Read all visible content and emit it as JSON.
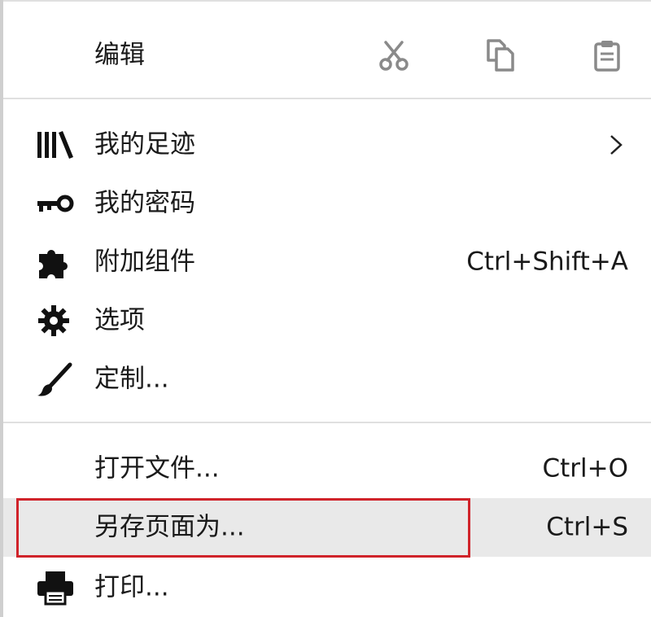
{
  "menu": {
    "edit": {
      "label": "编辑",
      "cut_icon": "scissors-icon",
      "copy_icon": "copy-icon",
      "paste_icon": "clipboard-icon"
    },
    "items": [
      {
        "label": "我的足迹",
        "icon": "library-icon",
        "submenu": true
      },
      {
        "label": "我的密码",
        "icon": "key-icon"
      },
      {
        "label": "附加组件",
        "icon": "puzzle-icon",
        "shortcut": "Ctrl+Shift+A"
      },
      {
        "label": "选项",
        "icon": "gear-icon"
      },
      {
        "label": "定制...",
        "icon": "paintbrush-icon"
      }
    ],
    "file_items": [
      {
        "label": "打开文件...",
        "shortcut": "Ctrl+O"
      },
      {
        "label": "另存页面为...",
        "shortcut": "Ctrl+S",
        "highlighted": true
      },
      {
        "label": "打印...",
        "icon": "printer-icon"
      }
    ],
    "colors": {
      "highlight_bg": "#e9e9e9",
      "focus_outline": "#d0232a",
      "separator": "#e0e0e0"
    }
  }
}
